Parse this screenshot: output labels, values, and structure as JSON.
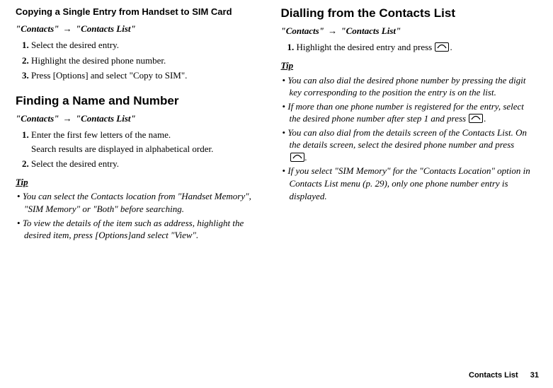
{
  "left": {
    "heading_sub": "Copying a Single Entry from Handset to SIM Card",
    "breadcrumb_a": "\"Contacts\"",
    "breadcrumb_b": "\"Contacts List\"",
    "steps": [
      "Select the desired entry.",
      "Highlight the desired phone number.",
      "Press [Options] and select \"Copy to SIM\"."
    ],
    "heading_main": "Finding a Name and Number",
    "breadcrumb2_a": "\"Contacts\"",
    "breadcrumb2_b": "\"Contacts List\"",
    "steps2": [
      {
        "text": "Enter the first few letters of the name.",
        "note": "Search results are displayed in alphabetical order."
      },
      {
        "text": "Select the desired entry."
      }
    ],
    "tip_label": "Tip",
    "tips": [
      "You can select the Contacts location from \"Handset Memory\", \"SIM Memory\" or \"Both\" before searching.",
      "To view the details of the item such as address, highlight the desired item, press [Options]and select \"View\"."
    ]
  },
  "right": {
    "heading_main": "Dialling from the Contacts List",
    "breadcrumb_a": "\"Contacts\"",
    "breadcrumb_b": "\"Contacts List\"",
    "step1_pre": "Highlight the desired entry and press ",
    "step1_post": ".",
    "tip_label": "Tip",
    "tip1": "You can also dial the desired phone number by pressing the digit key corresponding to the position the entry is on the list.",
    "tip2_pre": "If more than one phone number is registered for the entry, select the desired phone number after step 1 and press ",
    "tip2_post": ".",
    "tip3_pre": "You can also dial from the details screen of the Contacts List. On the details screen, select the desired phone number and press ",
    "tip3_post": ".",
    "tip4": "If you select \"SIM Memory\" for the \"Contacts Location\" option in Contacts List menu (p. 29), only one phone number entry is displayed."
  },
  "footer": {
    "title": "Contacts List",
    "page": "31"
  },
  "symbols": {
    "arrow": "→"
  }
}
